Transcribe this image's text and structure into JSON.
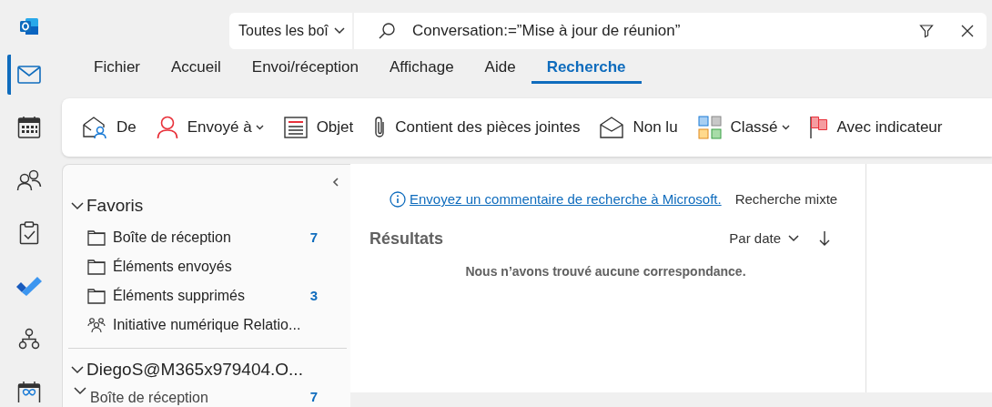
{
  "rail": [
    {
      "kind": "mail",
      "selected": true
    },
    {
      "kind": "calendar",
      "selected": false
    },
    {
      "kind": "people",
      "selected": false
    },
    {
      "kind": "tasks",
      "selected": false
    },
    {
      "kind": "todo",
      "selected": false
    },
    {
      "kind": "org",
      "selected": false
    },
    {
      "kind": "bookings",
      "selected": false
    }
  ],
  "search": {
    "scope": "Toutes les boî",
    "query": "Conversation:=”Mise à jour de réunion”"
  },
  "menu_tabs": [
    {
      "label": "Fichier",
      "selected": false
    },
    {
      "label": "Accueil",
      "selected": false
    },
    {
      "label": "Envoi/réception",
      "selected": false
    },
    {
      "label": "Affichage",
      "selected": false
    },
    {
      "label": "Aide",
      "selected": false
    },
    {
      "label": "Recherche",
      "selected": true
    }
  ],
  "ribbon": [
    {
      "kind": "from",
      "label": "De",
      "dropdown": false
    },
    {
      "kind": "sent_to",
      "label": "Envoyé à",
      "dropdown": true
    },
    {
      "kind": "subject",
      "label": "Objet",
      "dropdown": false
    },
    {
      "kind": "attachment",
      "label": "Contient des pièces jointes",
      "dropdown": false
    },
    {
      "kind": "unread",
      "label": "Non lu",
      "dropdown": false
    },
    {
      "kind": "categorized",
      "label": "Classé",
      "dropdown": true
    },
    {
      "kind": "flag",
      "label": "Avec indicateur",
      "dropdown": false
    }
  ],
  "folders": [
    {
      "label": "Favoris",
      "expanded": true,
      "children": [
        {
          "label": "Boîte de réception",
          "kind": "folder",
          "count": "7"
        },
        {
          "label": "Éléments envoyés",
          "kind": "folder"
        },
        {
          "label": "Éléments supprimés",
          "kind": "folder",
          "count": "3"
        },
        {
          "label": "Initiative numérique Relatio...",
          "kind": "group"
        }
      ]
    },
    {
      "label": "DiegoS@M365x979404.O...",
      "expanded": true,
      "children": [
        {
          "label": "Boîte de réception",
          "expanded": true,
          "count": "7"
        }
      ]
    }
  ],
  "results": {
    "feedback_link": "Envoyez un commentaire de recherche à Microsoft.",
    "mode": "Recherche mixte",
    "title": "Résultats",
    "sort": "Par date",
    "empty_message": "Nous n’avons trouvé aucune correspondance."
  }
}
